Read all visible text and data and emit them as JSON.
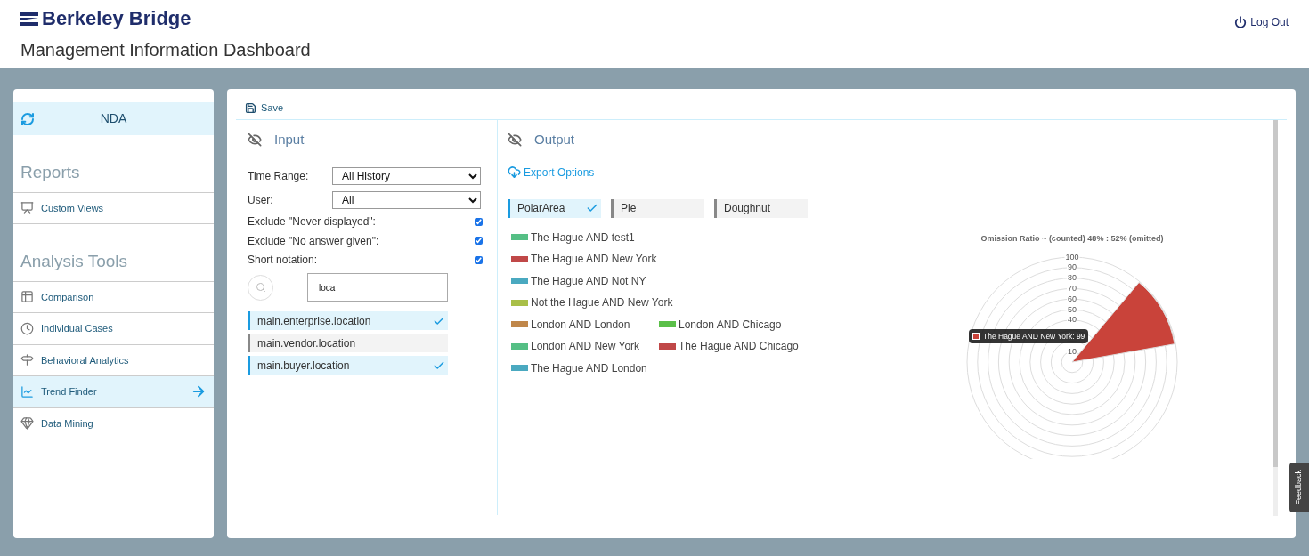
{
  "header": {
    "brand": "Berkeley Bridge",
    "logout": "Log Out",
    "title": "Management Information Dashboard"
  },
  "sidebar": {
    "project": "NDA",
    "sections": [
      {
        "heading": "Reports",
        "items": [
          {
            "label": "Custom Views",
            "kind": "views",
            "selected": false
          }
        ]
      },
      {
        "heading": "Analysis Tools",
        "items": [
          {
            "label": "Comparison",
            "kind": "table",
            "selected": false
          },
          {
            "label": "Individual Cases",
            "kind": "clock",
            "selected": false
          },
          {
            "label": "Behavioral Analytics",
            "kind": "signpost",
            "selected": false
          },
          {
            "label": "Trend Finder",
            "kind": "chart",
            "selected": true
          },
          {
            "label": "Data Mining",
            "kind": "gem",
            "selected": false
          }
        ]
      }
    ]
  },
  "toolbar": {
    "save": "Save"
  },
  "input": {
    "title": "Input",
    "selects": [
      {
        "label": "Time Range:",
        "value": "All History"
      },
      {
        "label": "User:",
        "value": "All"
      }
    ],
    "options": [
      {
        "label": "Exclude \"Never displayed\":",
        "checked": true
      },
      {
        "label": "Exclude \"No answer given\":",
        "checked": true
      },
      {
        "label": "Short notation:",
        "checked": true
      }
    ],
    "search": {
      "value": "loca"
    },
    "variables": [
      {
        "label": "main.enterprise.location",
        "selected": true
      },
      {
        "label": "main.vendor.location",
        "selected": false
      },
      {
        "label": "main.buyer.location",
        "selected": true
      }
    ]
  },
  "output": {
    "title": "Output",
    "export": "Export Options",
    "chart_types": [
      {
        "label": "PolarArea",
        "selected": true
      },
      {
        "label": "Pie",
        "selected": false
      },
      {
        "label": "Doughnut",
        "selected": false
      }
    ],
    "legend_rows": [
      [
        {
          "label": "The Hague AND test1",
          "color": "#55bf85"
        }
      ],
      [
        {
          "label": "The Hague AND New York",
          "color": "#c04848"
        }
      ],
      [
        {
          "label": "The Hague AND Not NY",
          "color": "#4aa9c0"
        }
      ],
      [
        {
          "label": "Not the Hague AND New York",
          "color": "#a9bf48"
        }
      ],
      [
        {
          "label": "London AND London",
          "color": "#c0874a"
        },
        {
          "label": "London AND Chicago",
          "color": "#5abf48"
        }
      ],
      [
        {
          "label": "London AND New York",
          "color": "#55bf85"
        },
        {
          "label": "The Hague AND Chicago",
          "color": "#c04848"
        }
      ],
      [
        {
          "label": "The Hague AND London",
          "color": "#4aa9c0"
        }
      ]
    ],
    "polar_chart": {
      "title": "Omission Ratio ~ (counted) 48% : 52% (omitted)",
      "ticks": [
        "100",
        "90",
        "80",
        "70",
        "60",
        "50",
        "40",
        "10"
      ],
      "tooltip": {
        "text": "The Hague AND New York: 99",
        "color": "#c9433a"
      }
    }
  },
  "feedback": "Feedback"
}
